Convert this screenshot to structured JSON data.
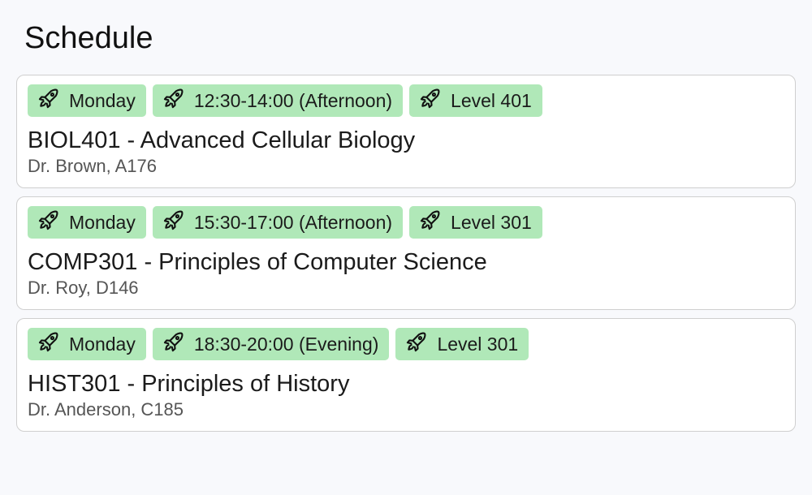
{
  "page": {
    "title": "Schedule"
  },
  "theme": {
    "tag_bg": "#b0e8b8",
    "card_border": "#cfcfcf"
  },
  "courses": [
    {
      "tags": [
        {
          "icon": "rocket-icon",
          "label": "Monday"
        },
        {
          "icon": "rocket-icon",
          "label": "12:30-14:00 (Afternoon)"
        },
        {
          "icon": "rocket-icon",
          "label": "Level 401"
        }
      ],
      "title": "BIOL401 - Advanced Cellular Biology",
      "subtitle": "Dr. Brown, A176"
    },
    {
      "tags": [
        {
          "icon": "rocket-icon",
          "label": "Monday"
        },
        {
          "icon": "rocket-icon",
          "label": "15:30-17:00 (Afternoon)"
        },
        {
          "icon": "rocket-icon",
          "label": "Level 301"
        }
      ],
      "title": "COMP301 - Principles of Computer Science",
      "subtitle": "Dr. Roy, D146"
    },
    {
      "tags": [
        {
          "icon": "rocket-icon",
          "label": "Monday"
        },
        {
          "icon": "rocket-icon",
          "label": "18:30-20:00 (Evening)"
        },
        {
          "icon": "rocket-icon",
          "label": "Level 301"
        }
      ],
      "title": "HIST301 - Principles of History",
      "subtitle": "Dr. Anderson, C185"
    }
  ]
}
